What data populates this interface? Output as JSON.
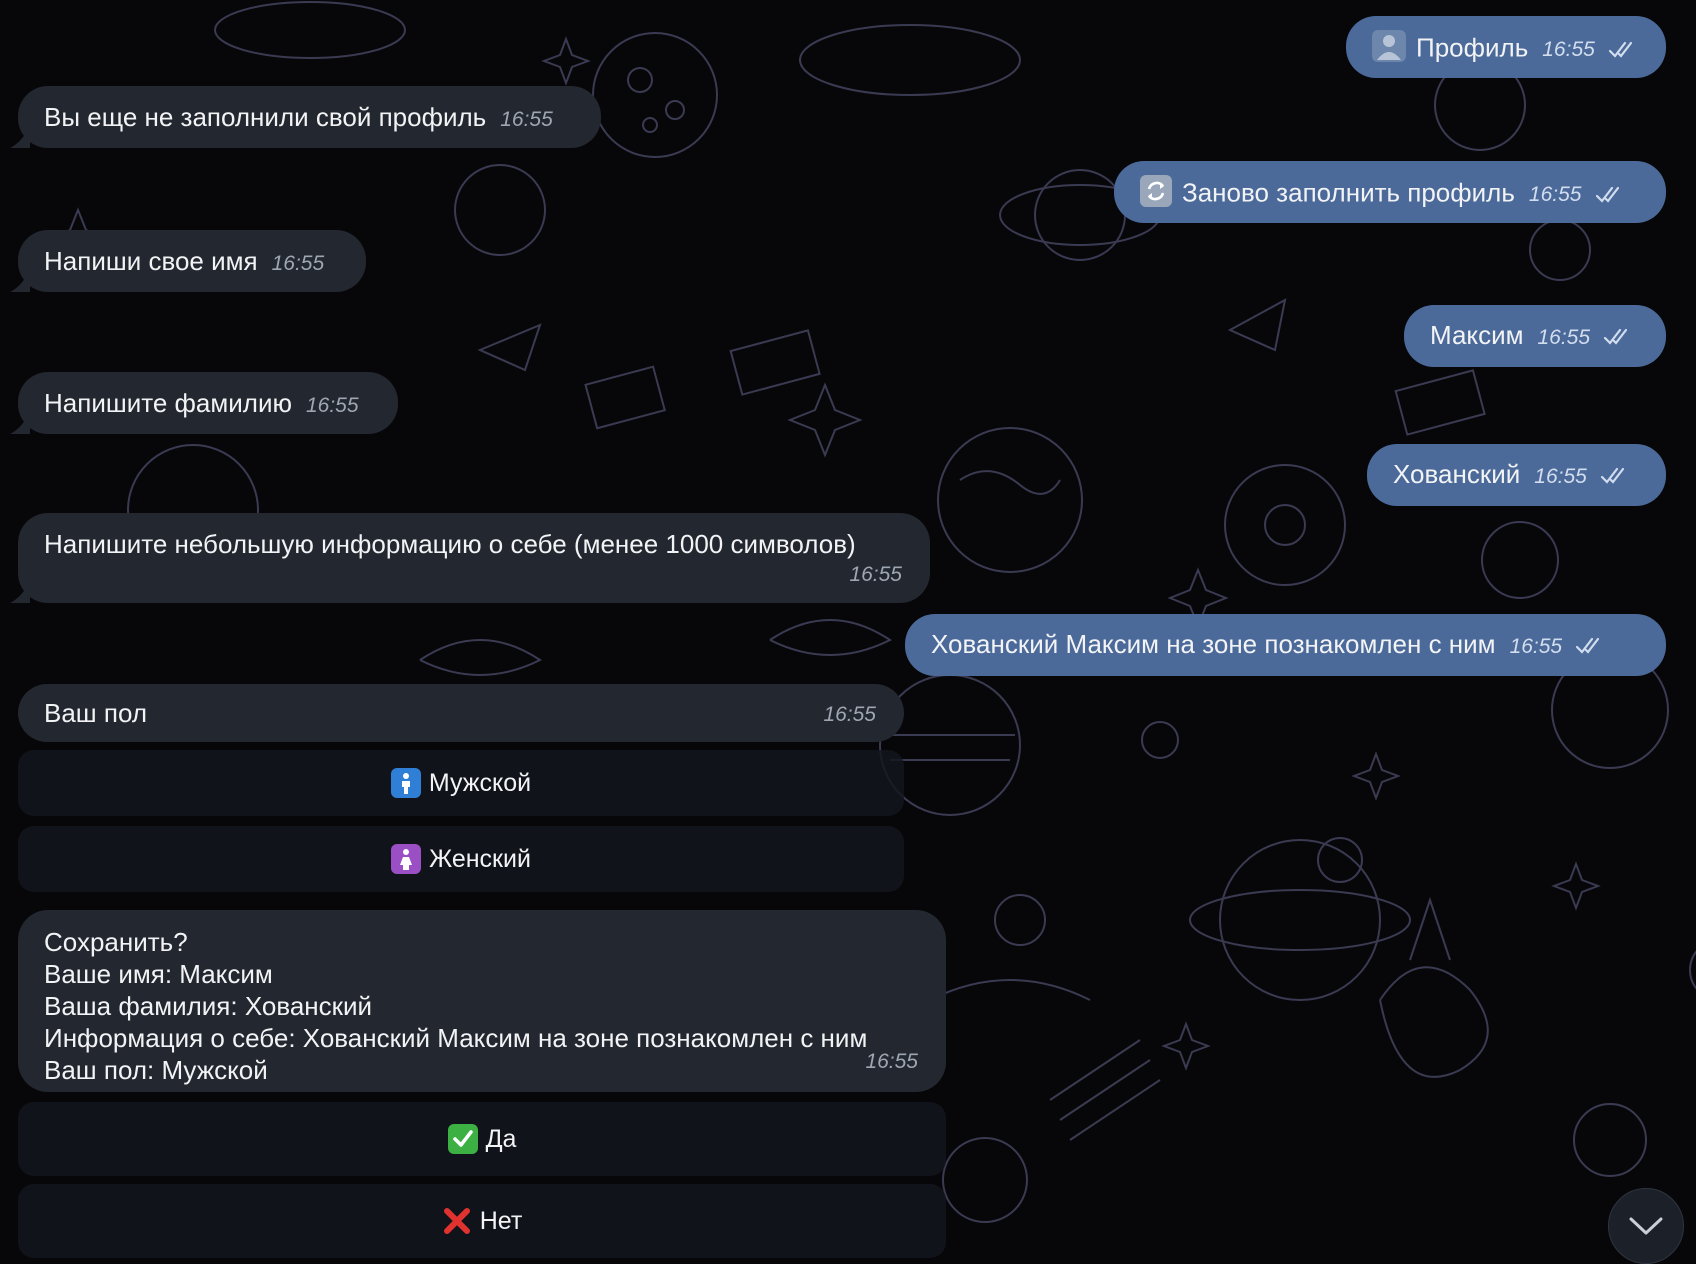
{
  "chat": {
    "incoming": [
      {
        "text": "Вы еще не заполнили свой профиль",
        "time": "16:55"
      },
      {
        "text": "Напиши свое имя",
        "time": "16:55"
      },
      {
        "text": "Напишите фамилию",
        "time": "16:55"
      },
      {
        "text": "Напишите небольшую информацию о себе (менее 1000 символов)",
        "time": "16:55"
      },
      {
        "text": "Ваш пол",
        "time": "16:55"
      }
    ],
    "outgoing": [
      {
        "text": "Профиль",
        "time": "16:55",
        "icon": "profile-silhouette-icon"
      },
      {
        "text": "Заново заполнить профиль",
        "time": "16:55",
        "icon": "refresh-icon"
      },
      {
        "text": "Максим",
        "time": "16:55"
      },
      {
        "text": "Хованский",
        "time": "16:55"
      },
      {
        "text": "Хованский Максим на зоне познакомлен с ним",
        "time": "16:55"
      }
    ],
    "gender_buttons": [
      {
        "label": "Мужской",
        "icon": "man-symbol-icon",
        "color": "#2f7fd6"
      },
      {
        "label": "Женский",
        "icon": "woman-symbol-icon",
        "color": "#9b4fc4"
      }
    ],
    "confirm": {
      "lines": [
        "Сохранить?",
        "Ваше имя: Максим",
        "Ваша фамилия: Хованский",
        "Информация о себе: Хованский Максим на зоне познакомлен с ним",
        "Ваш пол: Мужской"
      ],
      "time": "16:55"
    },
    "confirm_buttons": [
      {
        "label": "Да",
        "icon": "check-mark-button-icon",
        "color": "#3cb043"
      },
      {
        "label": "Нет",
        "icon": "cross-mark-icon",
        "color": "#e0322f"
      }
    ]
  },
  "colors": {
    "incoming_bubble": "#23272f",
    "outgoing_bubble": "#4b6a9a",
    "background": "#070709"
  },
  "icons": {
    "scroll_down": "chevron-down-icon",
    "read_receipt": "double-check-icon"
  }
}
